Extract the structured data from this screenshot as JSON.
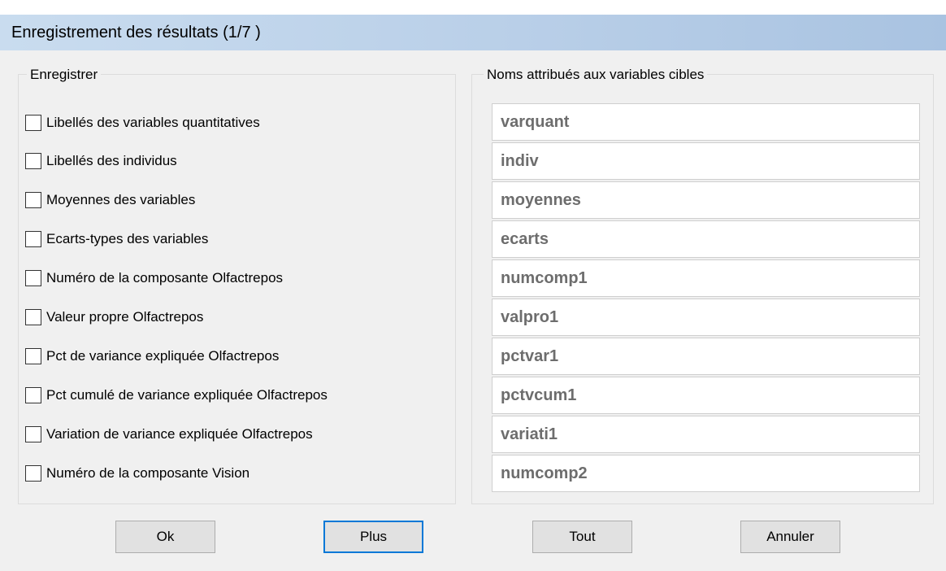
{
  "window": {
    "title": "Enregistrement des résultats (1/7 )"
  },
  "left_group": {
    "label": "Enregistrer",
    "items": [
      {
        "label": "Libellés des variables quantitatives",
        "checked": false
      },
      {
        "label": "Libellés des individus",
        "checked": false
      },
      {
        "label": "Moyennes des variables",
        "checked": false
      },
      {
        "label": "Ecarts-types des variables",
        "checked": false
      },
      {
        "label": "Numéro de la composante Olfactrepos",
        "checked": false
      },
      {
        "label": "Valeur propre Olfactrepos",
        "checked": false
      },
      {
        "label": "Pct de variance expliquée Olfactrepos",
        "checked": false
      },
      {
        "label": "Pct cumulé de variance expliquée Olfactrepos",
        "checked": false
      },
      {
        "label": "Variation de variance expliquée Olfactrepos",
        "checked": false
      },
      {
        "label": "Numéro de la composante Vision",
        "checked": false
      }
    ]
  },
  "right_group": {
    "label": "Noms attribués aux variables cibles",
    "fields": [
      "varquant",
      "indiv",
      "moyennes",
      "ecarts",
      "numcomp1",
      "valpro1",
      "pctvar1",
      "pctvcum1",
      "variati1",
      "numcomp2"
    ]
  },
  "buttons": {
    "ok": "Ok",
    "plus": "Plus",
    "tout": "Tout",
    "annuler": "Annuler"
  },
  "colors": {
    "focus_border": "#0078d7",
    "field_text": "#6d6d6d",
    "title_bar": "#b9cfe8"
  }
}
